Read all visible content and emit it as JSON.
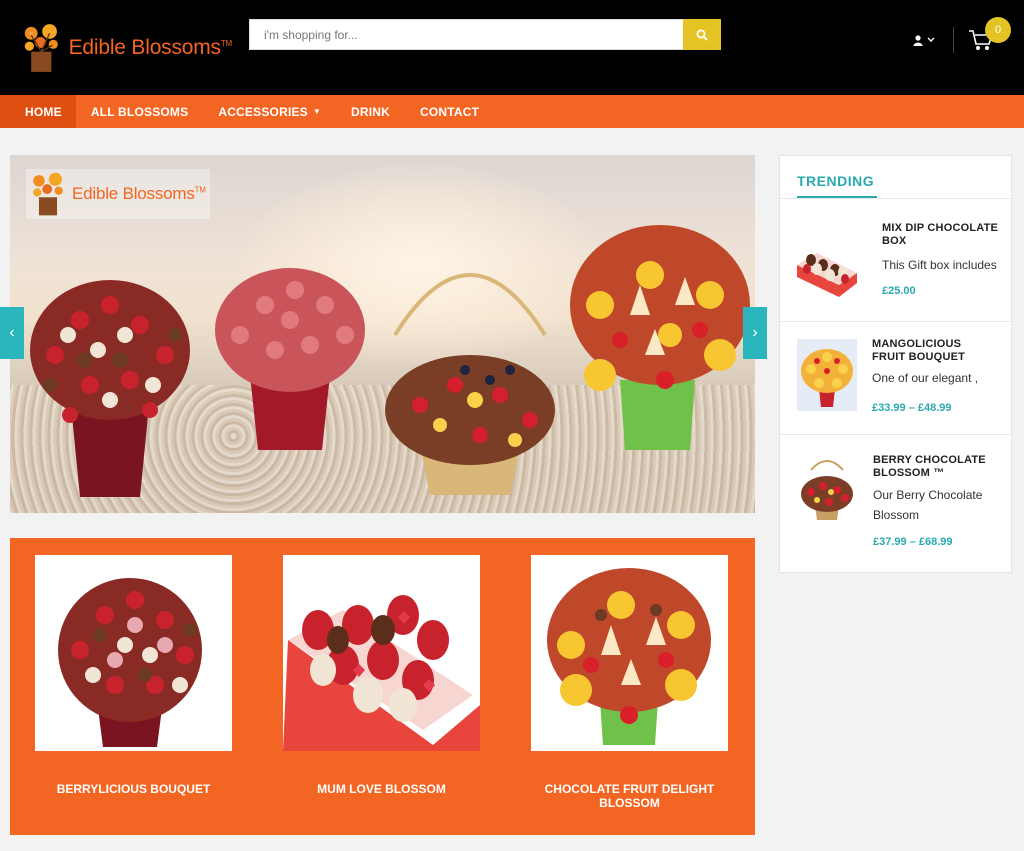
{
  "header": {
    "logo_text": "Edible Blossoms",
    "logo_tm": "TM",
    "search_placeholder": "i'm shopping for...",
    "cart_count": "0"
  },
  "nav": {
    "items": [
      {
        "label": "HOME",
        "active": true
      },
      {
        "label": "ALL BLOSSOMS"
      },
      {
        "label": "ACCESSORIES",
        "dropdown": true
      },
      {
        "label": "DRINK"
      },
      {
        "label": "CONTACT"
      }
    ]
  },
  "hero": {
    "logo_text": "Edible Blossoms",
    "logo_tm": "TM",
    "prev_arrow": "‹",
    "next_arrow": "›"
  },
  "products": [
    {
      "title": "BERRYLICIOUS BOUQUET"
    },
    {
      "title": "MUM LOVE BLOSSOM"
    },
    {
      "title": "CHOCOLATE FRUIT DELIGHT BLOSSOM"
    }
  ],
  "trending": {
    "title": "TRENDING",
    "items": [
      {
        "name": "MIX DIP CHOCOLATE BOX",
        "desc": "This Gift box includes",
        "price": "£25.00"
      },
      {
        "name": "MANGOLICIOUS FRUIT BOUQUET",
        "desc": "One of our elegant ,",
        "price": "£33.99  –  £48.99"
      },
      {
        "name": "BERRY CHOCOLATE BLOSSOM ™",
        "desc": "Our Berry Chocolate Blossom",
        "price": "£37.99  –  £68.99"
      }
    ]
  },
  "colors": {
    "brand_orange": "#f26522",
    "accent_teal": "#2aa9b1",
    "accent_yellow": "#e3c424"
  }
}
